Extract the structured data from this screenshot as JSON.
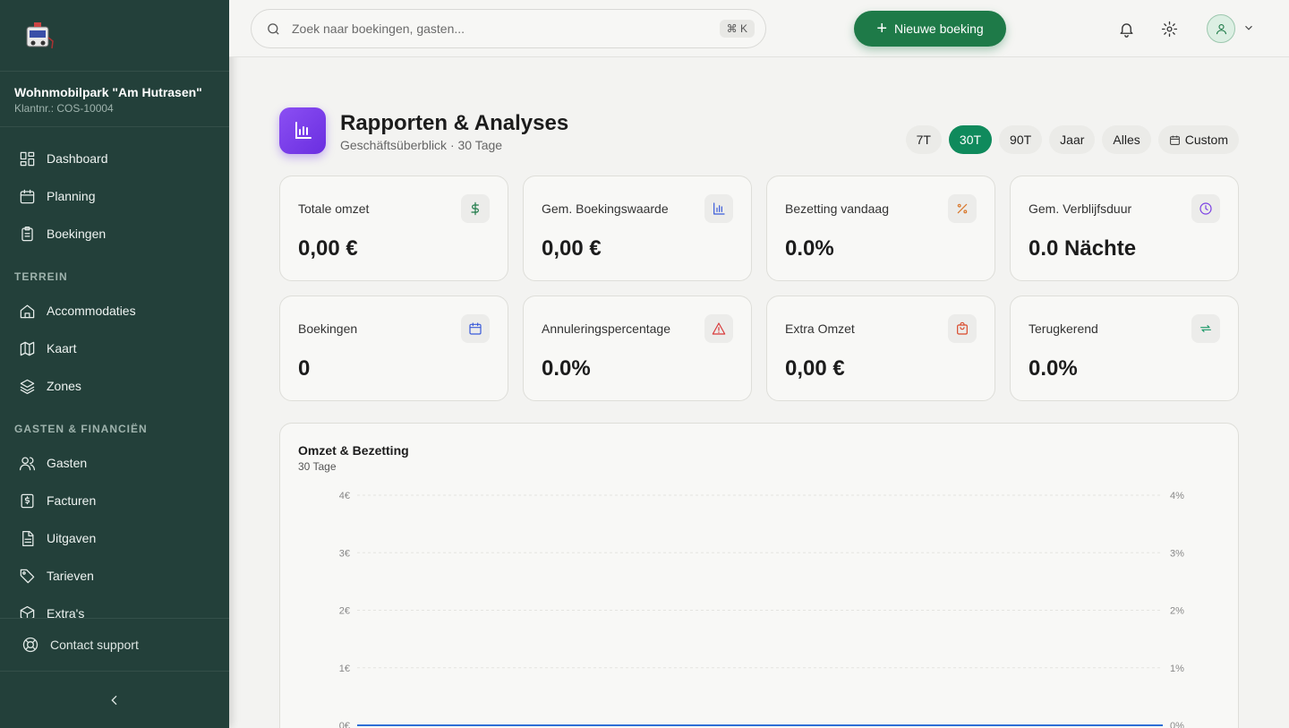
{
  "sidebar": {
    "park_name": "Wohnmobilpark \"Am Hutrasen\"",
    "customer_no": "Klantnr.: COS-10004",
    "items_main": [
      {
        "label": "Dashboard",
        "icon": "grid-icon"
      },
      {
        "label": "Planning",
        "icon": "calendar-icon"
      },
      {
        "label": "Boekingen",
        "icon": "clipboard-icon"
      }
    ],
    "section_terrein": "TERREIN",
    "items_terrein": [
      {
        "label": "Accommodaties",
        "icon": "home-icon"
      },
      {
        "label": "Kaart",
        "icon": "map-icon"
      },
      {
        "label": "Zones",
        "icon": "layers-icon"
      }
    ],
    "section_gasten": "GASTEN & FINANCIËN",
    "items_gasten": [
      {
        "label": "Gasten",
        "icon": "users-icon"
      },
      {
        "label": "Facturen",
        "icon": "invoice-icon"
      },
      {
        "label": "Uitgaven",
        "icon": "document-icon"
      },
      {
        "label": "Tarieven",
        "icon": "tag-icon"
      },
      {
        "label": "Extra's",
        "icon": "box-icon"
      }
    ],
    "support": "Contact support"
  },
  "header": {
    "search_placeholder": "Zoek naar boekingen, gasten...",
    "shortcut": "⌘ K",
    "new_booking": "Nieuwe boeking"
  },
  "page": {
    "title": "Rapporten & Analyses",
    "subtitle": "Geschäftsüberblick · 30 Tage",
    "ranges": [
      "7T",
      "30T",
      "90T",
      "Jaar",
      "Alles",
      "Custom"
    ],
    "active_range": "30T"
  },
  "kpis": [
    {
      "label": "Totale omzet",
      "value": "0,00 €",
      "icon": "dollar-icon",
      "color": "#1e7a48"
    },
    {
      "label": "Gem. Boekingswaarde",
      "value": "0,00 €",
      "icon": "bar-chart-icon",
      "color": "#3a5bd9"
    },
    {
      "label": "Bezetting vandaag",
      "value": "0.0%",
      "icon": "percent-icon",
      "color": "#d9772b"
    },
    {
      "label": "Gem. Verblijfsduur",
      "value": "0.0 Nächte",
      "icon": "clock-icon",
      "color": "#7b3fe4"
    },
    {
      "label": "Boekingen",
      "value": "0",
      "icon": "calendar-icon",
      "color": "#3a5bd9"
    },
    {
      "label": "Annuleringspercentage",
      "value": "0.0%",
      "icon": "alert-icon",
      "color": "#d93a3a"
    },
    {
      "label": "Extra Omzet",
      "value": "0,00 €",
      "icon": "bag-icon",
      "color": "#d94a2b"
    },
    {
      "label": "Terugkerend",
      "value": "0.0%",
      "icon": "repeat-icon",
      "color": "#1e9a6a"
    }
  ],
  "chart": {
    "title": "Omzet & Bezetting",
    "subtitle": "30 Tage"
  },
  "chart_data": {
    "type": "line",
    "title": "Omzet & Bezetting",
    "subtitle": "30 Tage",
    "y_left_ticks": [
      "4€",
      "3€",
      "2€",
      "1€",
      "0€"
    ],
    "y_right_ticks": [
      "4%",
      "3%",
      "2%",
      "1%",
      "0%"
    ],
    "ylim_left": [
      0,
      4
    ],
    "ylim_right": [
      0,
      4
    ],
    "series": [
      {
        "values": [
          0,
          0
        ],
        "color": "#2f6fd6"
      }
    ]
  }
}
